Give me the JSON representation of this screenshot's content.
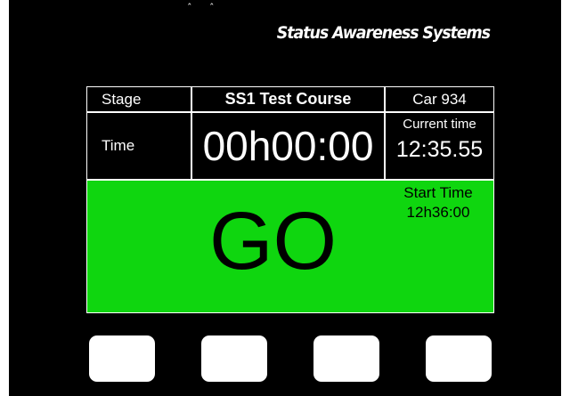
{
  "header": {
    "brand": "Status Awareness Systems",
    "carets": "ˆ ˆ"
  },
  "table": {
    "stage_label": "Stage",
    "stage_value": "SS1 Test Course",
    "car": "Car 934",
    "time_label": "Time",
    "elapsed_time": "00h00:00",
    "current_time_label": "Current time",
    "current_time": "12:35.55"
  },
  "status": {
    "text": "GO",
    "color": "#0fd60f",
    "start_time_label": "Start Time",
    "start_time": "12h36:00"
  },
  "softkeys": {
    "count": 4,
    "color": "#ffffff"
  }
}
